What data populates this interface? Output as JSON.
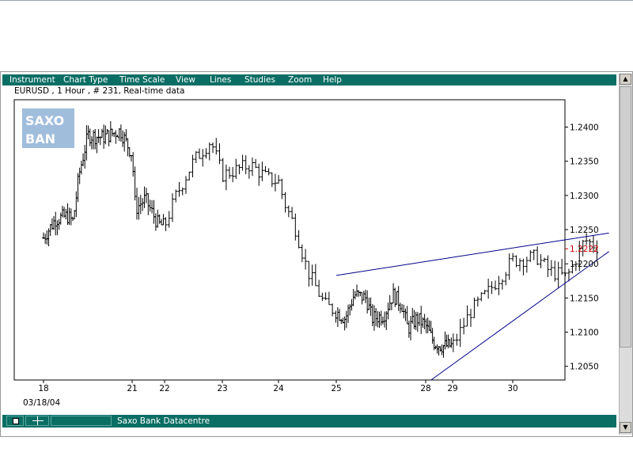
{
  "menu": {
    "items": [
      "Instrument",
      "Chart Type",
      "Time Scale",
      "View",
      "Lines",
      "Studies",
      "Zoom",
      "Help"
    ]
  },
  "chart_header": "EURUSD , 1 Hour , # 231, Real-time data",
  "logo_text": [
    "SAXO",
    "BAN"
  ],
  "status": {
    "source": "Saxo Bank Datacentre"
  },
  "colors": {
    "menubar": "#0a6e64",
    "trendline": "#00008b",
    "last_price": "#cc0000",
    "logo": "#7aa2c8"
  },
  "chart_data": {
    "type": "ohlc",
    "instrument": "EURUSD",
    "interval": "1 Hour",
    "bars": 231,
    "ylim": [
      1.203,
      1.244
    ],
    "y_ticks": [
      "1.2400",
      "1.2350",
      "1.2300",
      "1.2250",
      "1.2200",
      "1.2150",
      "1.2100",
      "1.2050"
    ],
    "last_price": "1.2222",
    "x_ticks": [
      {
        "label": "18",
        "day": 0
      },
      {
        "label": "21",
        "day": 3
      },
      {
        "label": "22",
        "day": 4
      },
      {
        "label": "23",
        "day": 5
      },
      {
        "label": "24",
        "day": 6
      },
      {
        "label": "25",
        "day": 7
      },
      {
        "label": "28",
        "day": 10
      },
      {
        "label": "29",
        "day": 11
      },
      {
        "label": "30",
        "day": 12
      }
    ],
    "start_date_label": "03/18/04",
    "close_path": [
      [
        0,
        1.2238
      ],
      [
        0.4,
        1.2265
      ],
      [
        0.8,
        1.227
      ],
      [
        1.0,
        1.2262
      ],
      [
        1.2,
        1.233
      ],
      [
        1.5,
        1.2388
      ],
      [
        2.0,
        1.2385
      ],
      [
        2.6,
        1.2395
      ],
      [
        3.0,
        1.236
      ],
      [
        3.1,
        1.228
      ],
      [
        3.4,
        1.2295
      ],
      [
        3.8,
        1.2258
      ],
      [
        4.0,
        1.2255
      ],
      [
        4.2,
        1.23
      ],
      [
        4.5,
        1.235
      ],
      [
        4.8,
        1.238
      ],
      [
        5.0,
        1.233
      ],
      [
        5.5,
        1.2345
      ],
      [
        5.8,
        1.2325
      ],
      [
        6.0,
        1.232
      ],
      [
        6.1,
        1.229
      ],
      [
        6.3,
        1.225
      ],
      [
        6.5,
        1.219
      ],
      [
        6.8,
        1.214
      ],
      [
        7.0,
        1.213
      ],
      [
        7.3,
        1.212
      ],
      [
        7.6,
        1.2155
      ],
      [
        8.0,
        1.215
      ],
      [
        8.2,
        1.212
      ],
      [
        8.6,
        1.2125
      ],
      [
        8.9,
        1.2155
      ],
      [
        9.2,
        1.214
      ],
      [
        9.4,
        1.2105
      ],
      [
        9.7,
        1.212
      ],
      [
        10.0,
        1.211
      ],
      [
        10.3,
        1.2085
      ],
      [
        10.6,
        1.208
      ],
      [
        11.0,
        1.208
      ],
      [
        11.3,
        1.213
      ],
      [
        11.6,
        1.216
      ],
      [
        12.0,
        1.2205
      ],
      [
        12.4,
        1.221
      ],
      [
        12.6,
        1.219
      ],
      [
        12.9,
        1.218
      ],
      [
        13.2,
        1.2235
      ],
      [
        13.4,
        1.2225
      ]
    ],
    "trendlines": [
      {
        "name": "upper",
        "points": [
          [
            7.0,
            1.2183
          ],
          [
            13.6,
            1.2245
          ]
        ]
      },
      {
        "name": "lower",
        "points": [
          [
            10.2,
            1.203
          ],
          [
            13.6,
            1.2218
          ]
        ]
      }
    ]
  }
}
